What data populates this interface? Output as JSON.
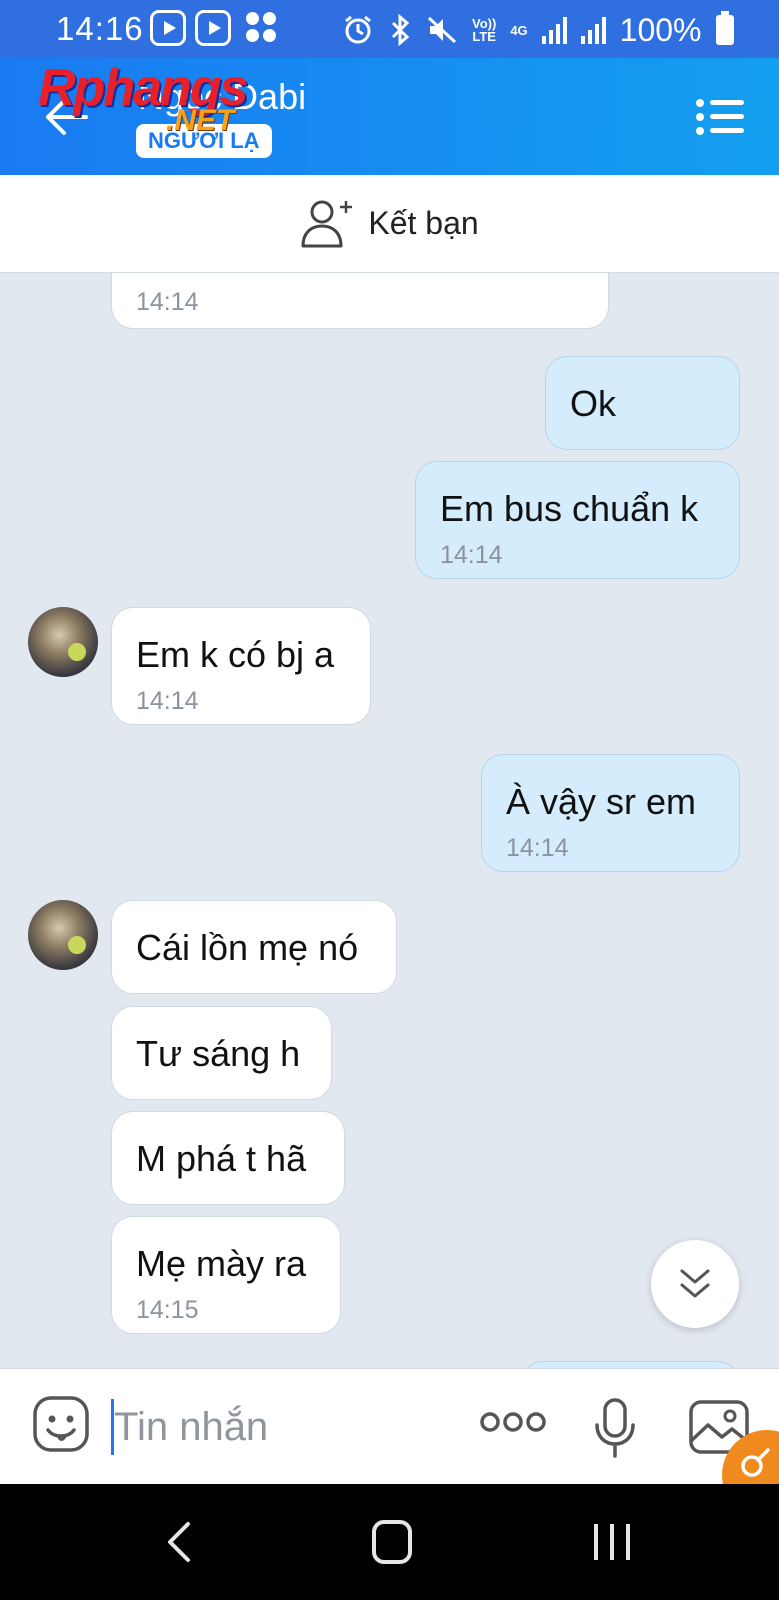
{
  "status_bar": {
    "time": "14:16",
    "volte_label": "Vo))\nLTE",
    "network_label": "4G",
    "battery": "100%"
  },
  "header": {
    "contact_name": "Ngọc Dabi",
    "stranger_badge": "NGƯỜI LẠ",
    "watermark": "Rphangs",
    "watermark_suffix": ".NET"
  },
  "add_friend": {
    "label": "Kết bạn"
  },
  "messages": [
    {
      "direction": "in",
      "text": "",
      "time": "14:14"
    },
    {
      "direction": "out",
      "text": "Ok",
      "time": ""
    },
    {
      "direction": "out",
      "text": "Em bus chuẩn k",
      "time": "14:14"
    },
    {
      "direction": "in",
      "text": "Em k có bj a",
      "time": "14:14"
    },
    {
      "direction": "out",
      "text": "À vậy sr em",
      "time": "14:14"
    },
    {
      "direction": "in",
      "text": "Cái lồn mẹ nó",
      "time": ""
    },
    {
      "direction": "in",
      "text": "Tư sáng h",
      "time": ""
    },
    {
      "direction": "in",
      "text": "M phá t hã",
      "time": ""
    },
    {
      "direction": "in",
      "text": "Mẹ mày ra",
      "time": "14:15"
    }
  ],
  "input_bar": {
    "placeholder": "Tin nhắn"
  },
  "colors": {
    "header_start": "#1a7af2",
    "header_end": "#139ff0",
    "outgoing_bubble": "#d5ecfd",
    "incoming_bubble": "#ffffff",
    "chat_background": "#e2e8f0"
  }
}
